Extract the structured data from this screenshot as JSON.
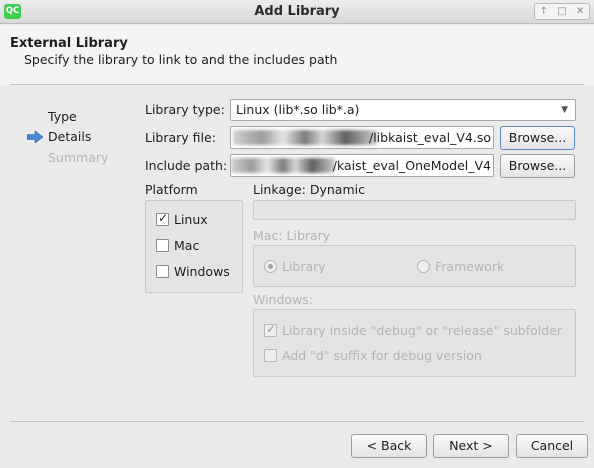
{
  "window": {
    "logo": "QC",
    "title": "Add Library",
    "controls": [
      "↑",
      "□",
      "✕"
    ]
  },
  "header": {
    "title": "External Library",
    "subtitle": "Specify the library to link to and the includes path"
  },
  "steps": {
    "type": "Type",
    "details": "Details",
    "summary": "Summary",
    "current": "Details"
  },
  "form": {
    "library_type_label": "Library type:",
    "library_type_value": "Linux (lib*.so lib*.a)",
    "library_file_label": "Library file:",
    "library_file_value": "/libkaist_eval_V4.so",
    "library_file_browse": "Browse...",
    "include_path_label": "Include path:",
    "include_path_value": "/kaist_eval_OneModel_V4",
    "include_path_browse": "Browse..."
  },
  "platform": {
    "label": "Platform",
    "linux": "Linux",
    "linux_checked": true,
    "mac": "Mac",
    "mac_checked": false,
    "windows": "Windows",
    "windows_checked": false
  },
  "linkage": {
    "label": "Linkage: Dynamic",
    "mac_group_label": "Mac: Library",
    "mac_library": "Library",
    "mac_framework": "Framework",
    "mac_selected": "Library",
    "windows_group_label": "Windows:",
    "win_debug_subfolder": "Library inside \"debug\" or \"release\" subfolder",
    "win_debug_subfolder_checked": true,
    "win_d_suffix": "Add \"d\" suffix for debug version",
    "win_d_suffix_checked": false
  },
  "buttons": {
    "back": "< Back",
    "next": "Next >",
    "cancel": "Cancel"
  },
  "colors": {
    "accent_arrow": "#4a86d4",
    "disabled_text": "#b4b4b4",
    "logo_green": "#41cd52"
  }
}
